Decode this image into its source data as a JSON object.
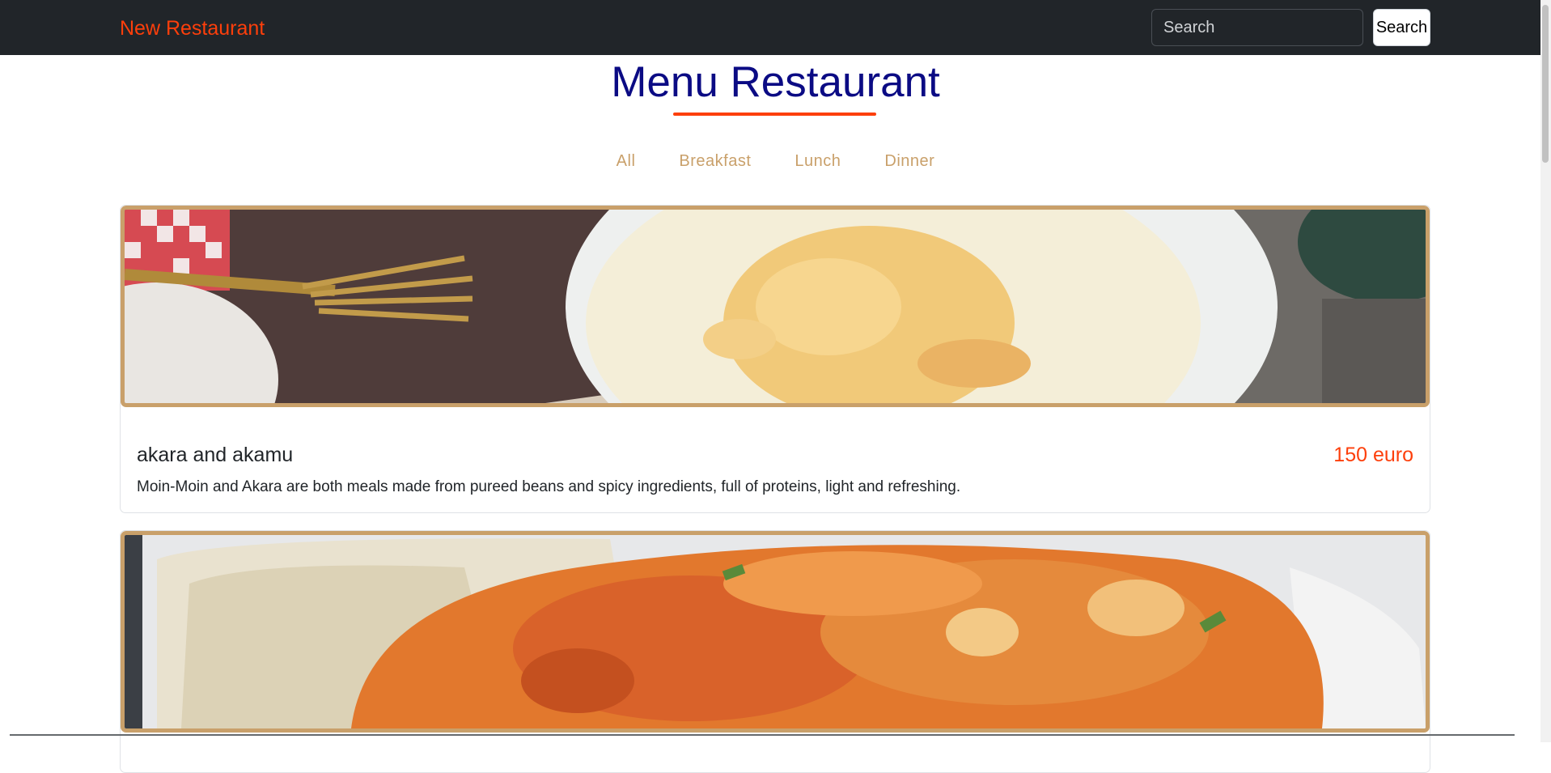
{
  "navbar": {
    "brand": "New Restaurant",
    "search_placeholder": "Search",
    "search_button": "Search"
  },
  "menu": {
    "title": "Menu Restaurant",
    "filters": [
      "All",
      "Breakfast",
      "Lunch",
      "Dinner"
    ]
  },
  "items": [
    {
      "name": "akara and akamu",
      "price": "150 euro",
      "description": "Moin-Moin and Akara are both meals made from pureed beans and spicy ingredients, full of proteins, light and refreshing."
    }
  ],
  "colors": {
    "navbar_bg": "#212529",
    "brand": "#fd3f0b",
    "title": "#0b0b84",
    "accent": "#fd3f0b",
    "filter_text": "#c9a06a",
    "card_border": "#c9a06a"
  }
}
